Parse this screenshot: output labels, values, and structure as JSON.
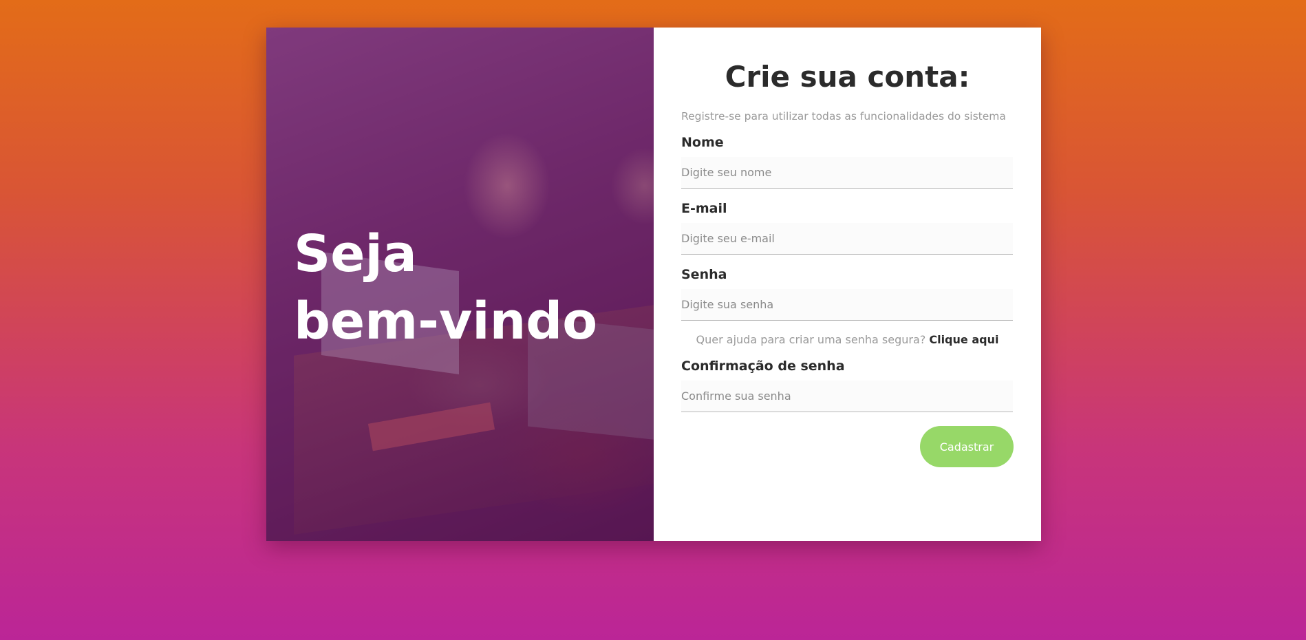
{
  "hero": {
    "line1": "Seja",
    "line2": "bem-vindo"
  },
  "form": {
    "title": "Crie sua conta:",
    "subtitle": "Registre-se para utilizar todas as funcionalidades do sistema",
    "fields": [
      {
        "label": "Nome",
        "placeholder": "Digite seu nome"
      },
      {
        "label": "E-mail",
        "placeholder": "Digite seu e-mail"
      },
      {
        "label": "Senha",
        "placeholder": "Digite sua senha"
      },
      {
        "label": "Confirmação de senha",
        "placeholder": "Confirme sua senha"
      }
    ],
    "help_text": "Quer ajuda para criar uma senha segura?",
    "help_link": "Clique aqui",
    "submit_label": "Cadastrar"
  },
  "colors": {
    "background_top": "#e36c18",
    "background_bottom": "#bb2597",
    "hero_overlay": "#6e2e6c",
    "submit": "#97d868",
    "title_text": "#2b2b2b"
  }
}
